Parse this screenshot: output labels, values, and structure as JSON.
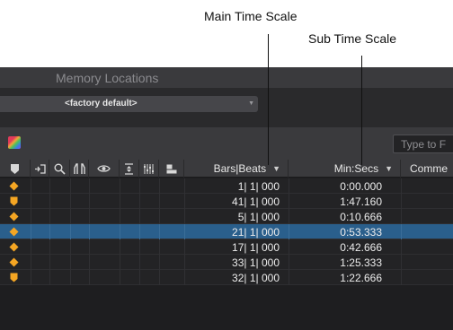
{
  "callouts": {
    "main": "Main Time Scale",
    "sub": "Sub Time Scale"
  },
  "window": {
    "title": "Memory Locations"
  },
  "toolbar": {
    "dropdown_value": "<factory default>",
    "search_placeholder": "Type to F"
  },
  "header": {
    "main_column": "Bars|Beats",
    "sub_column": "Min:Secs",
    "comments_column": "Comme",
    "sort_arrow": "▼",
    "icons": [
      "marker-icon",
      "selection-icon",
      "zoom-icon",
      "pre-post-roll-icon",
      "track-show-hide-icon",
      "track-height-icon",
      "group-enable-icon",
      "window-config-icon"
    ]
  },
  "rows": [
    {
      "marker": "diamond",
      "bars_beats": "1| 1| 000",
      "min_secs": "0:00.000",
      "selected": false
    },
    {
      "marker": "pin",
      "bars_beats": "41| 1| 000",
      "min_secs": "1:47.160",
      "selected": false
    },
    {
      "marker": "diamond",
      "bars_beats": "5| 1| 000",
      "min_secs": "0:10.666",
      "selected": false
    },
    {
      "marker": "diamond",
      "bars_beats": "21| 1| 000",
      "min_secs": "0:53.333",
      "selected": true
    },
    {
      "marker": "diamond",
      "bars_beats": "17| 1| 000",
      "min_secs": "0:42.666",
      "selected": false
    },
    {
      "marker": "diamond",
      "bars_beats": "33| 1| 000",
      "min_secs": "1:25.333",
      "selected": false
    },
    {
      "marker": "pin",
      "bars_beats": "32| 1| 000",
      "min_secs": "1:22.666",
      "selected": false
    }
  ],
  "colors": {
    "marker": "#f5a623",
    "selected_row": "#2a5f8c"
  }
}
